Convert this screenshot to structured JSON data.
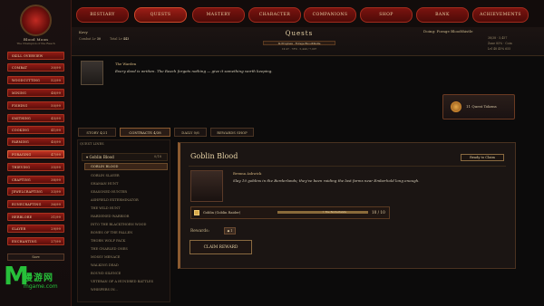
{
  "player": {
    "name": "Blood Moon",
    "subtitle": "The Champion of the Reach"
  },
  "sidebar": {
    "skills": [
      {
        "label": "Skill Overview",
        "level": ""
      },
      {
        "label": "Combat",
        "level": "30/99"
      },
      {
        "label": "Woodcutting",
        "level": "52/99"
      },
      {
        "label": "Mining",
        "level": "48/99"
      },
      {
        "label": "Fishing",
        "level": "50/99"
      },
      {
        "label": "Smithing",
        "level": "45/99"
      },
      {
        "label": "Cooking",
        "level": "41/99"
      },
      {
        "label": "Farming",
        "level": "40/99"
      },
      {
        "label": "Foraging",
        "level": "47/99"
      },
      {
        "label": "Thieving",
        "level": "35/99"
      },
      {
        "label": "Crafting",
        "level": "38/99"
      },
      {
        "label": "Jewelcrafting",
        "level": "33/99"
      },
      {
        "label": "Runecrafting",
        "level": "36/99"
      },
      {
        "label": "Herblore",
        "level": "31/99"
      },
      {
        "label": "Slayer",
        "level": "29/99"
      },
      {
        "label": "Enchanting",
        "level": "27/99"
      }
    ],
    "save_label": "Save"
  },
  "nav": [
    "Bestiary",
    "Quests",
    "Mastery",
    "Character",
    "Companions",
    "Shop",
    "Bank",
    "Achievements"
  ],
  "header": {
    "character_name": "Kovy",
    "combat_label": "Combat Lv",
    "combat_value": "30",
    "total_label": "Total Lv",
    "total_value": "443",
    "title": "Quests",
    "progress": "In Progress · Forage Bloodthistle",
    "stats": "1K 47 · 78% · 5,449 / 7,007",
    "doing": "Doing: Forage Bloodthistle",
    "r1": "38/38 · 5,457",
    "r2": "Zone 85% · Coin",
    "r3": "Lvl 48 45% 655"
  },
  "npc": {
    "name": "The Warden",
    "text": "Every deed is written. The Reach forgets nothing — give it something worth keeping."
  },
  "token": {
    "text": "11 Quest Tokens"
  },
  "tabs": [
    {
      "label": "Story 4/21"
    },
    {
      "label": "Contracts 4/38"
    },
    {
      "label": "Daily 0/6"
    },
    {
      "label": "Rewards Shop"
    }
  ],
  "quest_list": {
    "header": "Quest Lines",
    "group_label": "Goblin Blood",
    "group_count": "0/18",
    "items": [
      "Goblin Blood",
      "Goblin Slayer",
      "Shaman Hunt",
      "Seasoned Hunter",
      "Ashfield Exterminator",
      "The Wild Hunt",
      "Hardened Warrior",
      "Into the Blackthorn Wood",
      "Bones of the Fallen",
      "Thorn Wolf Pack",
      "The Gnarled Ones",
      "Mossy Menace",
      "Walking Dead",
      "Bound Silence",
      "Veteran of a Hundred Battles",
      "Whispers in..."
    ]
  },
  "detail": {
    "title": "Goblin Blood",
    "status": "Ready to Claim",
    "giver_name": "Brenna Ashwick",
    "giver_text": "Slay 10 goblins in the Borderlands; they've been raiding the last farms near Emberhold long enough.",
    "objective_label": "Goblin (Goblin Raider)",
    "objective_location": "↑ The Borderlands",
    "objective_count": "10 / 10",
    "rewards_label": "Rewards:",
    "reward_chip": "◆ 1",
    "claim_label": "Claim Reward"
  },
  "watermark": {
    "mark": "M",
    "name": "漫游网",
    "url": "mgame.com"
  },
  "colors": {
    "accent_red": "#8f1a14",
    "gold": "#e9d4a8",
    "panel": "#1b1513"
  }
}
